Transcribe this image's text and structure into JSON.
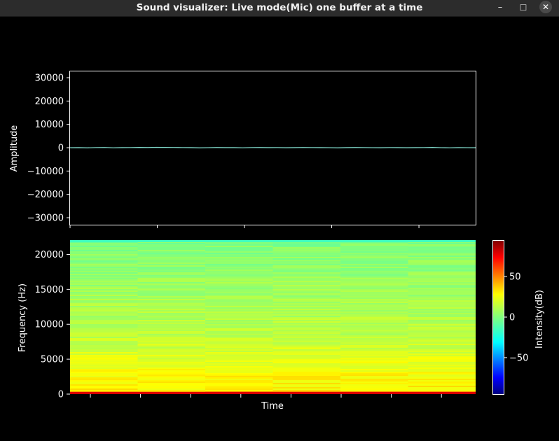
{
  "window": {
    "title": "Sound visualizer: Live mode(Mic) one buffer at a time",
    "buttons": {
      "minimize": "–",
      "maximize": "☐",
      "close": "✕"
    }
  },
  "colors": {
    "background": "#000000",
    "axes_frame": "#ffffff",
    "waveform": "#7fd8c9",
    "text": "#ffffff",
    "titlebar": "#2c2c2c"
  },
  "chart_data": [
    {
      "type": "line",
      "title": "",
      "xlabel": "",
      "ylabel": "Amplitude",
      "ylim": [
        -33000,
        33000
      ],
      "yticks": [
        30000,
        20000,
        10000,
        0,
        -10000,
        -20000,
        -30000
      ],
      "ytick_labels": [
        "30000",
        "20000",
        "10000",
        "0",
        "−10000",
        "−20000",
        "−30000"
      ],
      "x_tick_count": 5,
      "series": [
        {
          "values": [
            0,
            40,
            -30,
            60,
            90,
            -20,
            30,
            50,
            120,
            80,
            160,
            110,
            90,
            60,
            40,
            -40,
            20,
            70,
            40,
            30,
            -20,
            50,
            80,
            40,
            60,
            10,
            30,
            90,
            60,
            30,
            20,
            -30,
            40,
            70,
            50,
            20,
            0,
            60,
            40,
            10,
            30,
            50,
            120,
            20,
            -20,
            40,
            20,
            0
          ]
        }
      ]
    },
    {
      "type": "heatmap",
      "title": "",
      "xlabel": "Time",
      "ylabel": "Frequency (Hz)",
      "ylim": [
        0,
        22050
      ],
      "yticks": [
        0,
        5000,
        10000,
        15000,
        20000
      ],
      "ytick_labels": [
        "0",
        "5000",
        "10000",
        "15000",
        "20000"
      ],
      "x_tick_count": 8,
      "colormap": "jet",
      "colorbar": {
        "label": "Intensity(dB)",
        "range": [
          -95,
          95
        ],
        "ticks": [
          50,
          0,
          -50
        ],
        "tick_labels": [
          "50",
          "0",
          "−50"
        ]
      },
      "intensity_profile_db": {
        "low_band_0_500hz": 65,
        "band_500_2000hz": 30,
        "band_2000_8000hz": 15,
        "band_8000_22050hz": 0,
        "top_edge": -15
      }
    }
  ]
}
